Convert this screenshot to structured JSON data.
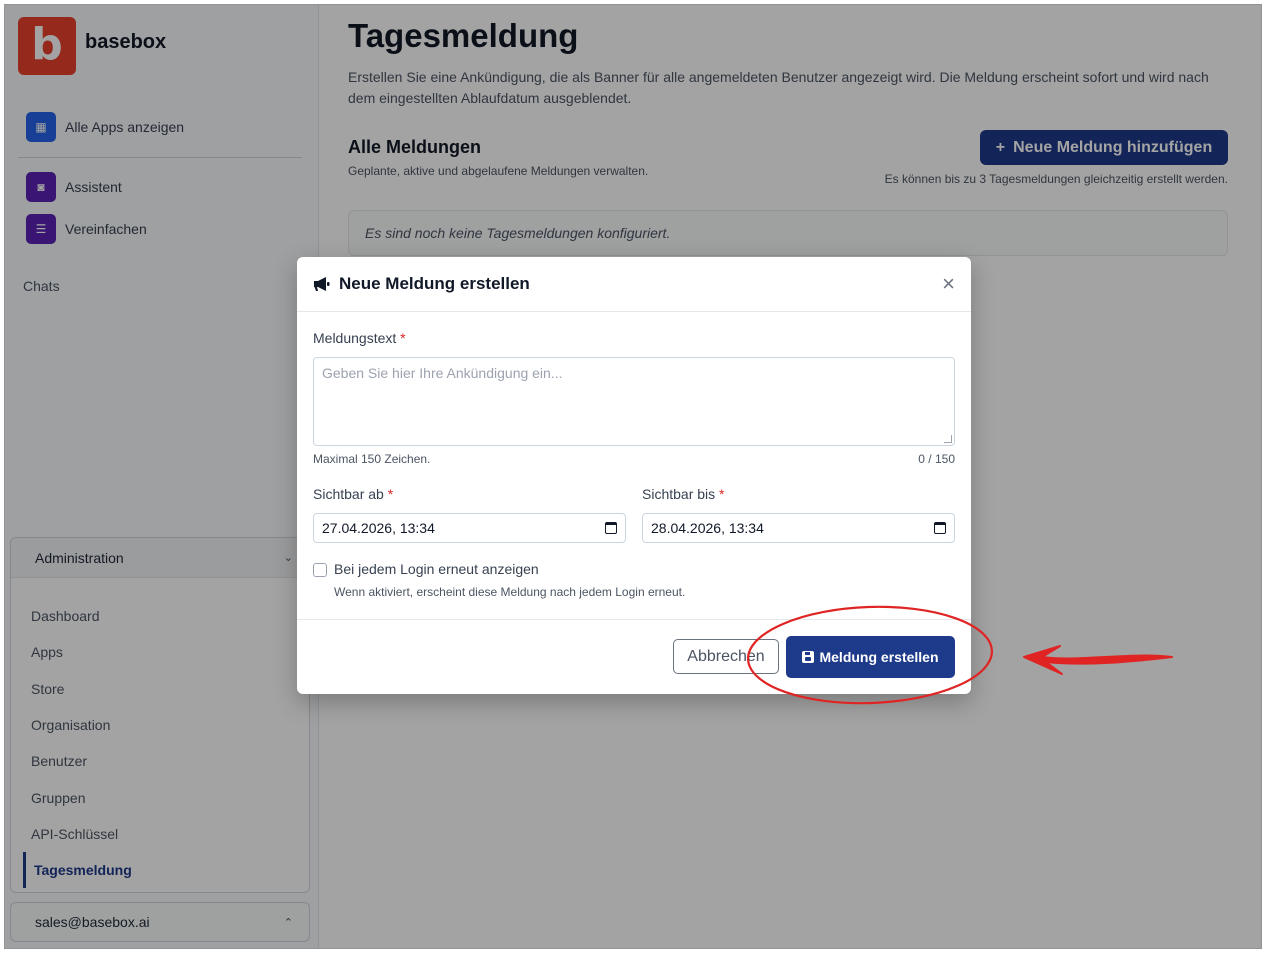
{
  "sidebar": {
    "brand_letter": "b",
    "brand_name": "basebox",
    "nav": [
      {
        "label": "Alle Apps anzeigen"
      },
      {
        "label": "Assistent"
      },
      {
        "label": "Vereinfachen"
      }
    ],
    "chats_label": "Chats",
    "admin": {
      "header": "Administration",
      "items": [
        "Dashboard",
        "Apps",
        "Store",
        "Organisation",
        "Benutzer",
        "Gruppen",
        "API-Schlüssel",
        "Tagesmeldung"
      ],
      "active": "Tagesmeldung"
    },
    "user_email": "sales@basebox.ai"
  },
  "main": {
    "title": "Tagesmeldung",
    "description": "Erstellen Sie eine Ankündigung, die als Banner für alle angemeldeten Benutzer angezeigt wird. Die Meldung erscheint sofort und wird nach dem eingestellten Ablaufdatum ausgeblendet.",
    "section_title": "Alle Meldungen",
    "section_desc": "Geplante, aktive und abgelaufene Meldungen verwalten.",
    "add_button": "Neue Meldung hinzufügen",
    "add_hint": "Es können bis zu 3 Tagesmeldungen gleichzeitig erstellt werden.",
    "empty_text": "Es sind noch keine Tagesmeldungen konfiguriert."
  },
  "modal": {
    "title": "Neue Meldung erstellen",
    "message_label": "Meldungstext",
    "required_mark": "*",
    "message_placeholder": "Geben Sie hier Ihre Ankündigung ein...",
    "max_hint": "Maximal 150 Zeichen.",
    "counter": "0 / 150",
    "visible_from_label": "Sichtbar ab",
    "visible_from_value": "27.04.2026, 13:34",
    "visible_until_label": "Sichtbar bis",
    "visible_until_value": "28.04.2026, 13:34",
    "checkbox_label": "Bei jedem Login erneut anzeigen",
    "checkbox_checked": false,
    "checkbox_hint": "Wenn aktiviert, erscheint diese Meldung nach jedem Login erneut.",
    "cancel_button": "Abbrechen",
    "create_button": "Meldung erstellen"
  },
  "colors": {
    "primary": "#1e3a8a",
    "brand": "#e8412c",
    "annotation": "#e02424"
  }
}
